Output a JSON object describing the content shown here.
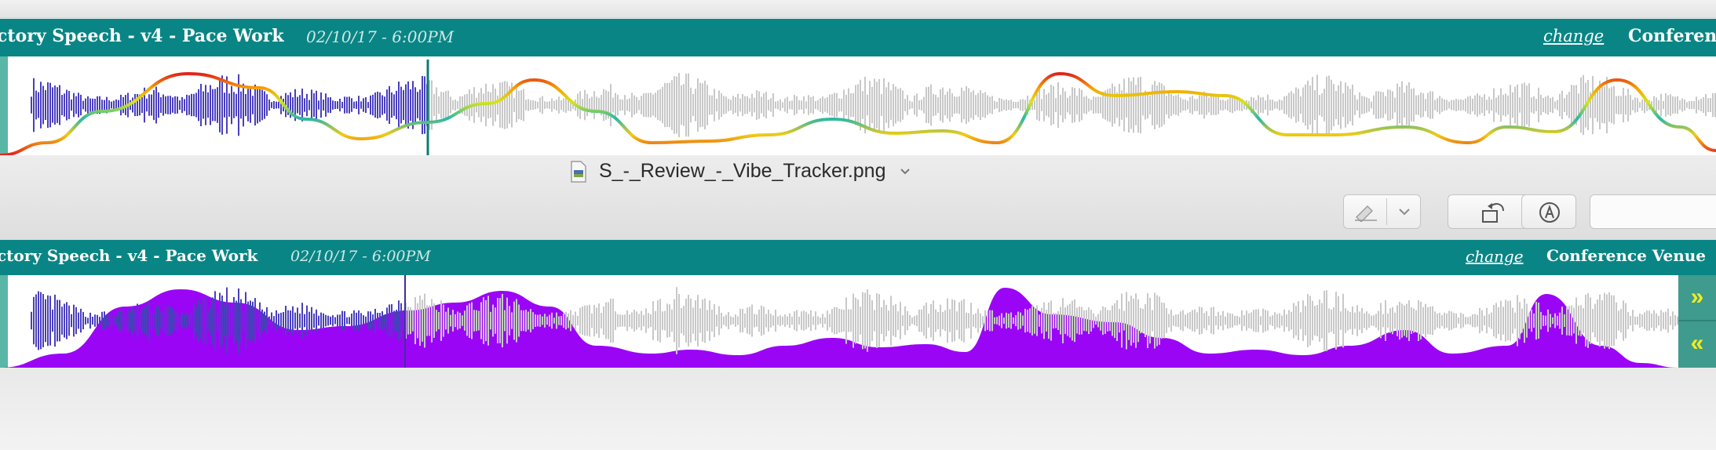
{
  "tracks": [
    {
      "title": "ctory Speech - v4 - Pace Work",
      "date": "02/10/17 - 6:00PM",
      "change_label": "change",
      "venue_label": "Conferenc"
    },
    {
      "title": "ctory Speech - v4 - Pace Work",
      "date": "02/10/17 - 6:00PM",
      "change_label": "change",
      "venue_label": "Conference Venue"
    }
  ],
  "preview": {
    "filename": "S_-_Review_-_Vibe_Tracker.png"
  },
  "nav": {
    "forward_label": "»",
    "back_label": "«"
  },
  "colors": {
    "header_teal": "#0a8585",
    "wave_played": "#4a3fbe",
    "wave_unplayed": "#c8c8c8",
    "vibe_fill": "#9b05f5",
    "arrow_yellow": "#f2ec20"
  },
  "icons": {
    "file": "png-file-icon",
    "markup": "markup-pen-icon",
    "dropdown": "chevron-down-icon",
    "rotate": "rotate-left-icon",
    "annotate": "annotate-circle-icon"
  }
}
